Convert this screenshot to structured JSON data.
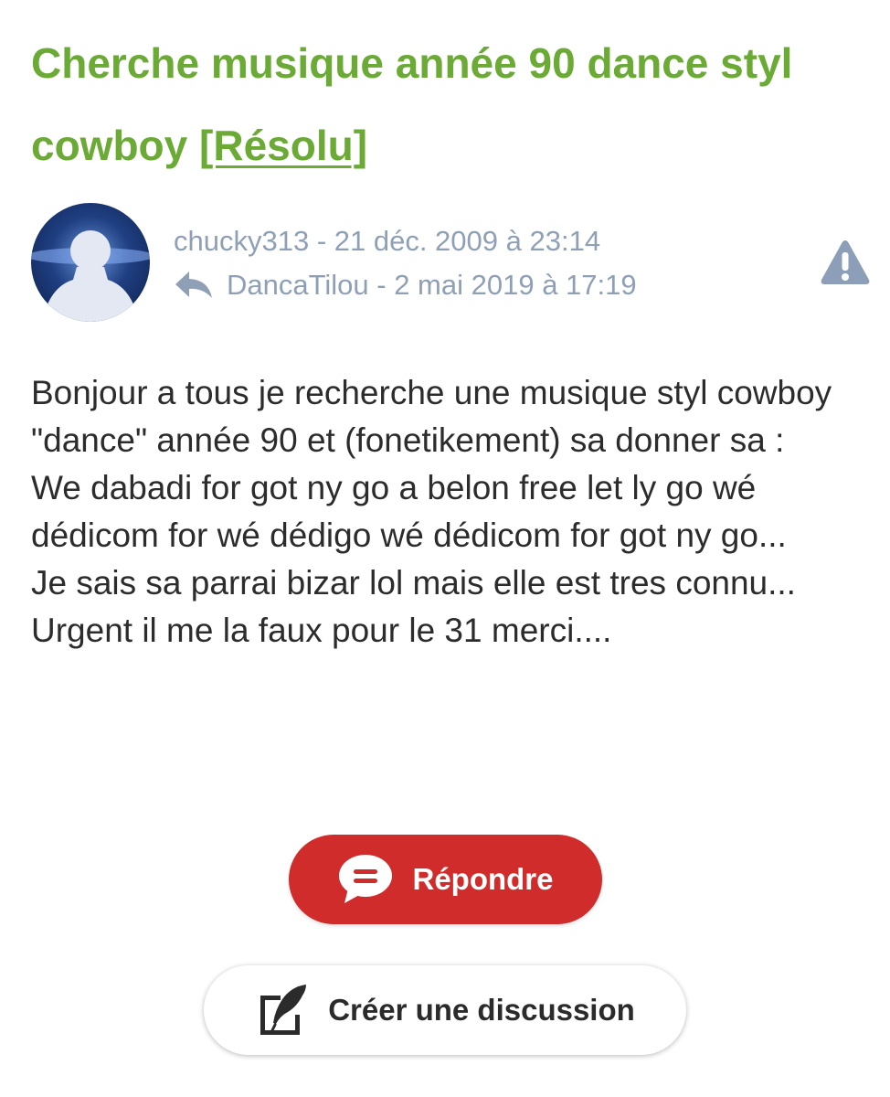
{
  "post": {
    "title": "Cherche musique année 90 dance styl cowboy",
    "resolved_tag": "[Résolu]",
    "author_line": "chucky313 - 21 déc. 2009 à 23:14",
    "last_reply_line": "DancaTilou - 2 mai 2019 à 17:19",
    "body_lines": [
      "Bonjour a tous je recherche une musique styl cowboy \"dance\" année 90 et (fonetikement) sa donner sa :",
      "We dabadi for got ny go a belon free let ly go wé dédicom for wé dédigo wé dédicom for got ny go...",
      "Je sais sa parrai bizar lol mais elle est tres connu...",
      "Urgent il me la faux pour le 31 merci...."
    ]
  },
  "actions": {
    "reply_label": "Répondre",
    "create_discussion_label": "Créer une discussion"
  },
  "icons": {
    "avatar": "default-user-silhouette",
    "reply_arrow": "reply-arrow-icon",
    "report": "warning-triangle-icon",
    "reply_button": "speech-bubble-icon",
    "create_button": "edit-pen-icon"
  },
  "colors": {
    "title_green": "#6aaa35",
    "meta_gray": "#8fa0b6",
    "reply_red": "#d02c2c",
    "body_text": "#2c2c2c"
  }
}
